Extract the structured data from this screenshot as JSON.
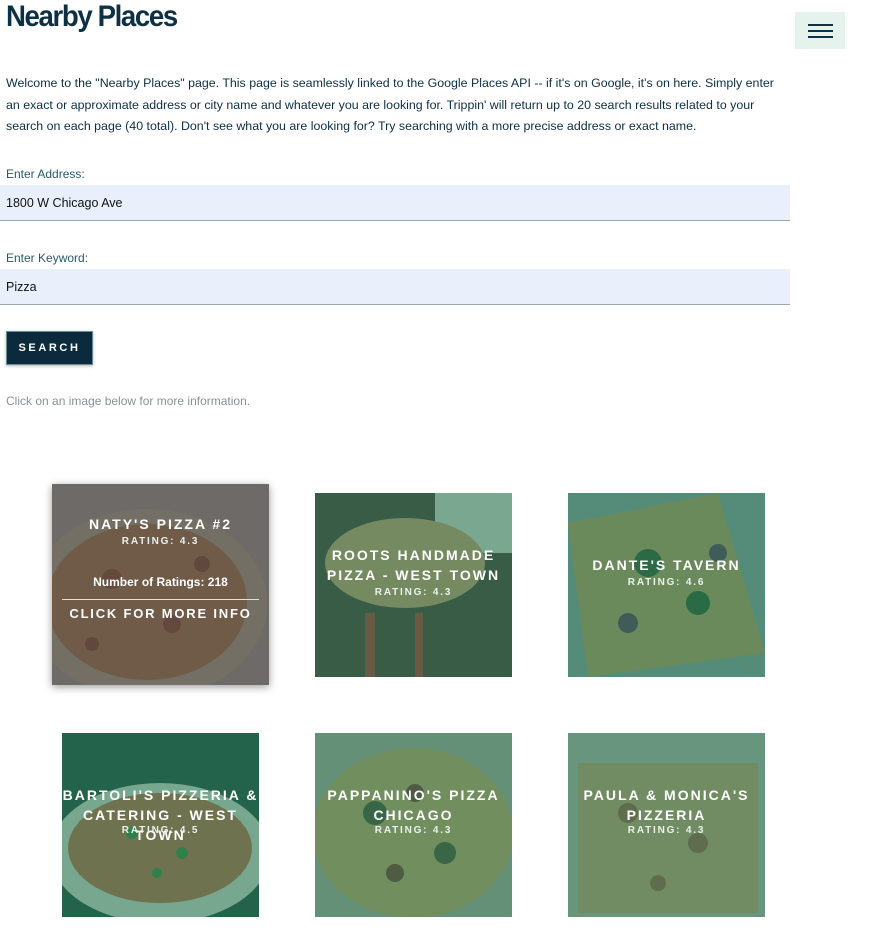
{
  "header": {
    "title": "Nearby Places",
    "menu_icon": "hamburger-icon"
  },
  "intro": "Welcome to the \"Nearby Places\" page. This page is seamlessly linked to the Google Places API -- if it's on Google, it's on here. Simply enter an exact or approximate address or city name and whatever you are looking for. Trippin' will return up to 20 search results related to your search on each page (40 total). Don't see what you are looking for? Try searching with a more precise address or exact name.",
  "form": {
    "address_label": "Enter Address:",
    "address_value": "1800 W Chicago Ave",
    "keyword_label": "Enter Keyword:",
    "keyword_value": "Pizza",
    "search_label": "SEARCH"
  },
  "hint": "Click on an image below for more information.",
  "results": [
    {
      "name": "Naty's Pizza #2",
      "rating": "Rating: 4.3",
      "ratings_count": "Number of Ratings: 218",
      "more": "Click for more info",
      "hovered": true
    },
    {
      "name": "Roots Handmade Pizza - West Town",
      "rating": "Rating: 4.3"
    },
    {
      "name": "Dante's Tavern",
      "rating": "Rating: 4.6"
    },
    {
      "name": "Bartoli's Pizzeria & Catering - West Town",
      "rating": "Rating: 4.5"
    },
    {
      "name": "Pappanino's Pizza Chicago",
      "rating": "Rating: 4.3"
    },
    {
      "name": "Paula & Monica's Pizzeria",
      "rating": "Rating: 4.3"
    }
  ],
  "colors": {
    "brand_dark": "#0d3044",
    "field_bg": "#e9f0fc",
    "menu_bg": "#e6f2ec",
    "card_tint": "#1e785a"
  }
}
